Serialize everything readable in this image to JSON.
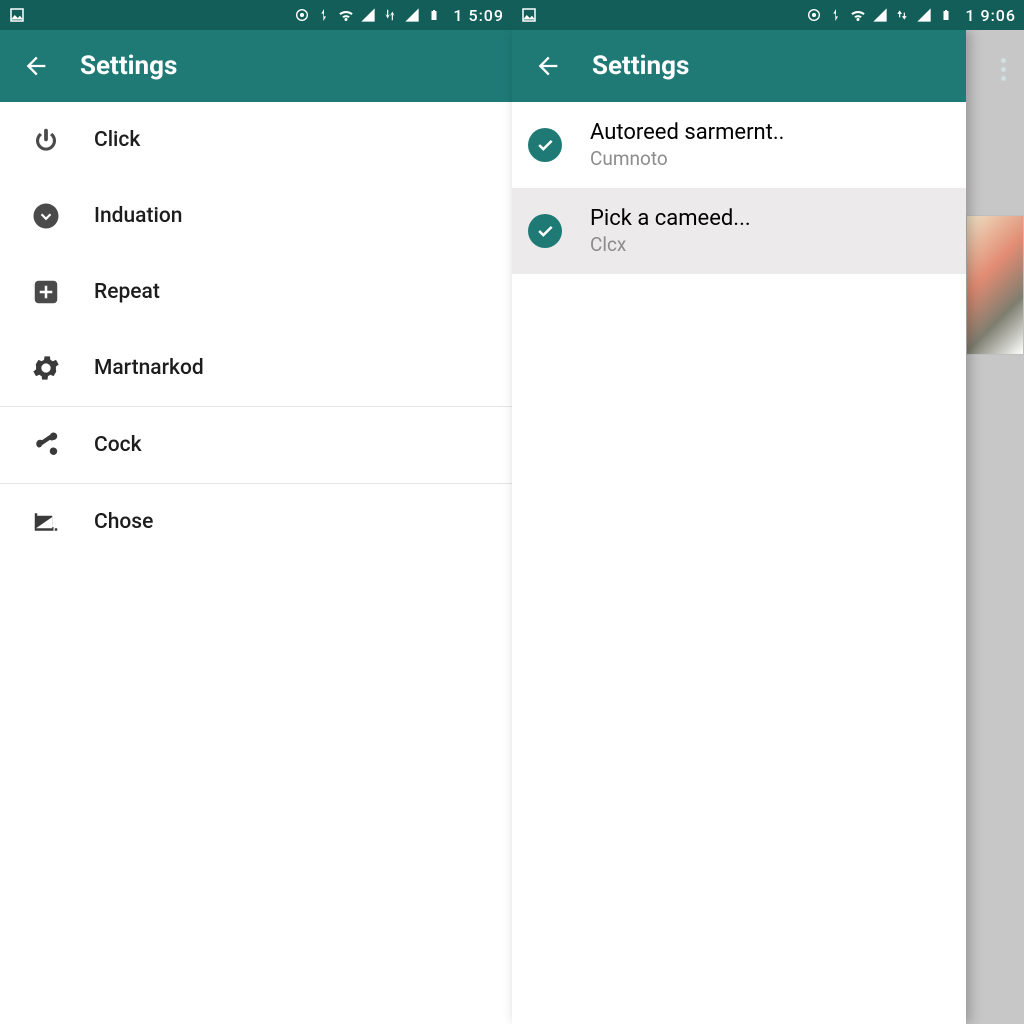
{
  "left": {
    "statusbar": {
      "time": "1 5:09"
    },
    "appbar": {
      "title": "Settings"
    },
    "items": [
      {
        "icon": "power",
        "label": "Click"
      },
      {
        "icon": "download",
        "label": "Induation"
      },
      {
        "icon": "plus",
        "label": "Repeat"
      },
      {
        "icon": "gear",
        "label": "Martnarkod"
      },
      {
        "icon": "share",
        "label": "Cock"
      },
      {
        "icon": "crop",
        "label": "Chose"
      }
    ]
  },
  "right": {
    "statusbar": {
      "time": "1 9:06"
    },
    "appbar": {
      "title": "Settings"
    },
    "items": [
      {
        "title": "Autoreed sarmernt..",
        "subtitle": "Cumnoto",
        "selected": false
      },
      {
        "title": "Pick a cameed...",
        "subtitle": "Clcx",
        "selected": true
      }
    ]
  }
}
